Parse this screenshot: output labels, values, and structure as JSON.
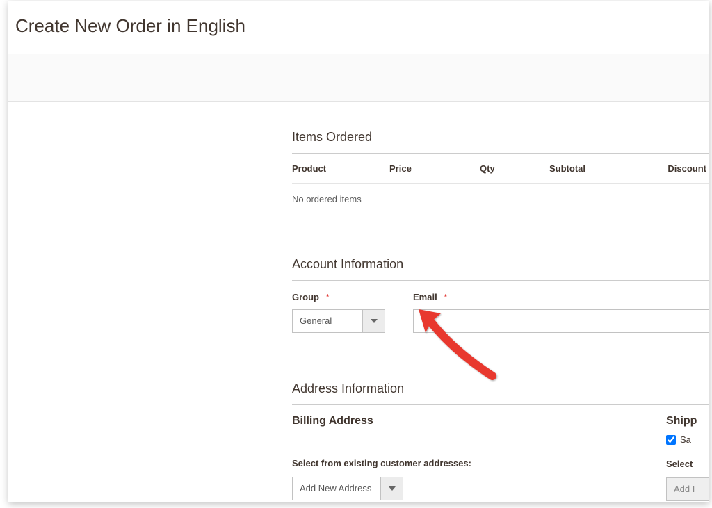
{
  "page_title": "Create New Order in English",
  "items_ordered": {
    "title": "Items Ordered",
    "columns": {
      "product": "Product",
      "price": "Price",
      "qty": "Qty",
      "subtotal": "Subtotal",
      "discount": "Discount"
    },
    "empty_message": "No ordered items"
  },
  "account_info": {
    "title": "Account Information",
    "group_label": "Group",
    "group_value": "General",
    "email_label": "Email",
    "email_value": ""
  },
  "address_info": {
    "title": "Address Information",
    "billing": {
      "title": "Billing Address",
      "existing_label": "Select from existing customer addresses:",
      "select_value": "Add New Address"
    },
    "shipping": {
      "title_partial": "Shipp",
      "same_as_partial": "Sa",
      "same_as_checked": true,
      "existing_label": "Select",
      "select_value_partial": "Add I"
    }
  },
  "required_marker": "*"
}
